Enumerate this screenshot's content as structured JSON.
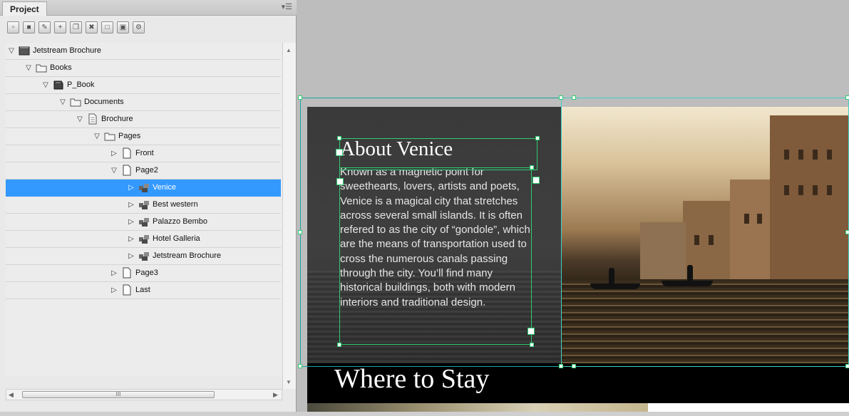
{
  "panel": {
    "tab_label": "Project",
    "menu_icon": "panel-menu-icon"
  },
  "toolbar": {
    "buttons": [
      {
        "name": "open-icon"
      },
      {
        "name": "save-icon"
      },
      {
        "name": "edit-icon"
      },
      {
        "name": "add-icon"
      },
      {
        "name": "duplicate-icon"
      },
      {
        "name": "delete-icon"
      },
      {
        "name": "blank-page-icon"
      },
      {
        "name": "preview-icon"
      },
      {
        "name": "settings-icon"
      }
    ]
  },
  "tree": {
    "items": [
      {
        "label": "Jetstream Brochure",
        "level": 0,
        "expanded": true,
        "icon": "project-icon"
      },
      {
        "label": "Books",
        "level": 1,
        "expanded": true,
        "icon": "folder-icon"
      },
      {
        "label": "P_Book",
        "level": 2,
        "expanded": true,
        "icon": "book-icon"
      },
      {
        "label": "Documents",
        "level": 3,
        "expanded": true,
        "icon": "folder-icon"
      },
      {
        "label": "Brochure",
        "level": 4,
        "expanded": true,
        "icon": "document-icon"
      },
      {
        "label": "Pages",
        "level": 5,
        "expanded": true,
        "icon": "folder-icon"
      },
      {
        "label": "Front",
        "level": 6,
        "expanded": false,
        "icon": "page-icon"
      },
      {
        "label": "Page2",
        "level": 6,
        "expanded": true,
        "icon": "page-icon"
      },
      {
        "label": "Venice",
        "level": 7,
        "expanded": false,
        "icon": "component-icon",
        "selected": true
      },
      {
        "label": "Best western",
        "level": 7,
        "expanded": false,
        "icon": "component-icon"
      },
      {
        "label": "Palazzo Bembo",
        "level": 7,
        "expanded": false,
        "icon": "component-icon"
      },
      {
        "label": "Hotel Galleria",
        "level": 7,
        "expanded": false,
        "icon": "component-icon"
      },
      {
        "label": "Jetstream Brochure",
        "level": 7,
        "expanded": false,
        "icon": "component-icon"
      },
      {
        "label": "Page3",
        "level": 6,
        "expanded": false,
        "icon": "page-icon"
      },
      {
        "label": "Last",
        "level": 6,
        "expanded": false,
        "icon": "page-icon"
      }
    ]
  },
  "scrollbar": {
    "h_thumb_grip": "III"
  },
  "document": {
    "heading": "About Venice",
    "body": "Known as a magnetic point for sweethearts, lovers, artists and poets, Venice is a magical city that stretches across several small islands. It is often refered to as the city of “gondole”, which are the means of transportation used to cross the numerous canals passing through the city. You’ll find many historical buildings, both with modern interiors and traditional design.",
    "section_heading": "Where to Stay"
  },
  "colors": {
    "selection": "#3399ff",
    "frame_green": "#2ecc71",
    "frame_cyan": "#1aa5a5"
  }
}
